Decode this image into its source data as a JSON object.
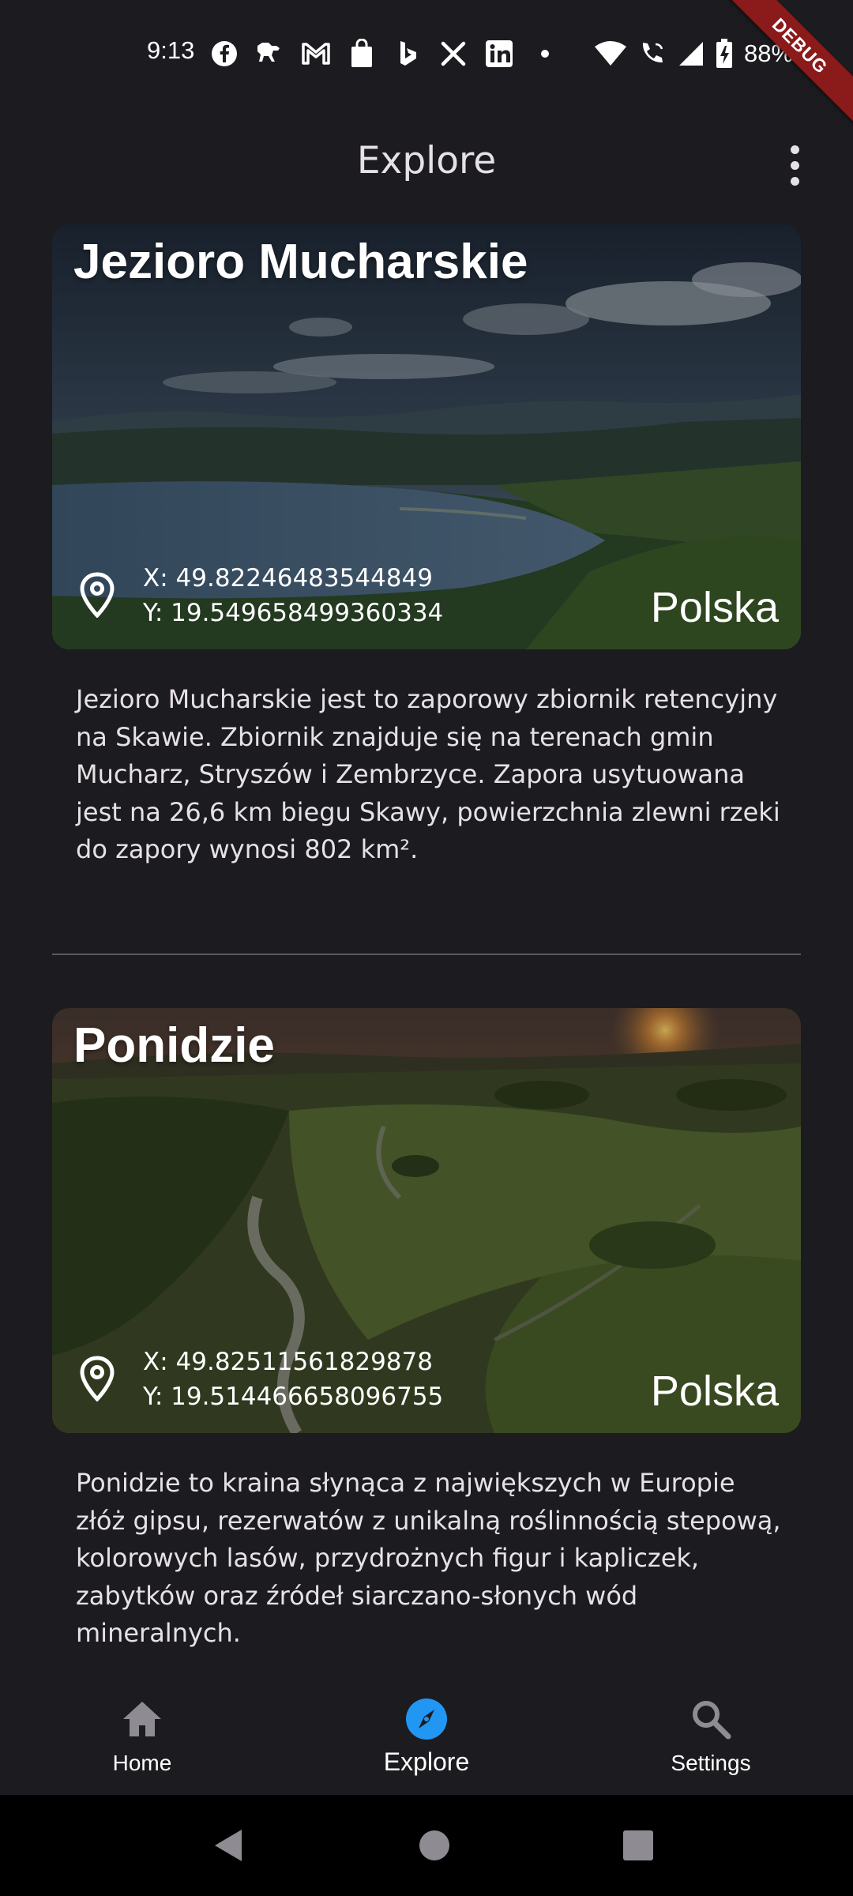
{
  "status_bar": {
    "time": "9:13",
    "battery_percent": "88%",
    "notification_icons": [
      "facebook-icon",
      "dog-app-icon",
      "gmail-icon",
      "shopping-bag-icon",
      "bing-icon",
      "x-icon",
      "linkedin-icon",
      "more-dot-icon"
    ],
    "debug_banner": "DEBUG"
  },
  "app_bar": {
    "title": "Explore"
  },
  "places": [
    {
      "name": "Jezioro Mucharskie",
      "x_coord": "X: 49.82246483544849",
      "y_coord": "Y: 19.549658499360334",
      "country": "Polska",
      "description": "Jezioro Mucharskie jest to zaporowy zbiornik retencyjny na Skawie. Zbiornik znajduje się na terenach gmin Mucharz, Stryszów i Zembrzyce. Zapora usytuowana jest na 26,6 km biegu Skawy, powierzchnia zlewni rzeki do zapory wynosi 802 km²."
    },
    {
      "name": "Ponidzie",
      "x_coord": "X: 49.82511561829878",
      "y_coord": "Y: 19.514466658096755",
      "country": "Polska",
      "description": "Ponidzie to kraina słynąca z największych w Europie złóż gipsu, rezerwatów z unikalną roślinnością stepową, kolorowych lasów, przydrożnych figur i kapliczek, zabytków oraz źródeł siarczano-słonych wód mineralnych."
    }
  ],
  "bottom_nav": {
    "items": [
      {
        "label": "Home",
        "icon": "home-icon",
        "active": false
      },
      {
        "label": "Explore",
        "icon": "compass-icon",
        "active": true
      },
      {
        "label": "Settings",
        "icon": "search-icon",
        "active": false
      }
    ]
  },
  "colors": {
    "background": "#1c1b1f",
    "accent": "#2196f3",
    "text": "#e6e1e5",
    "debug_ribbon": "#8b1a1a"
  }
}
